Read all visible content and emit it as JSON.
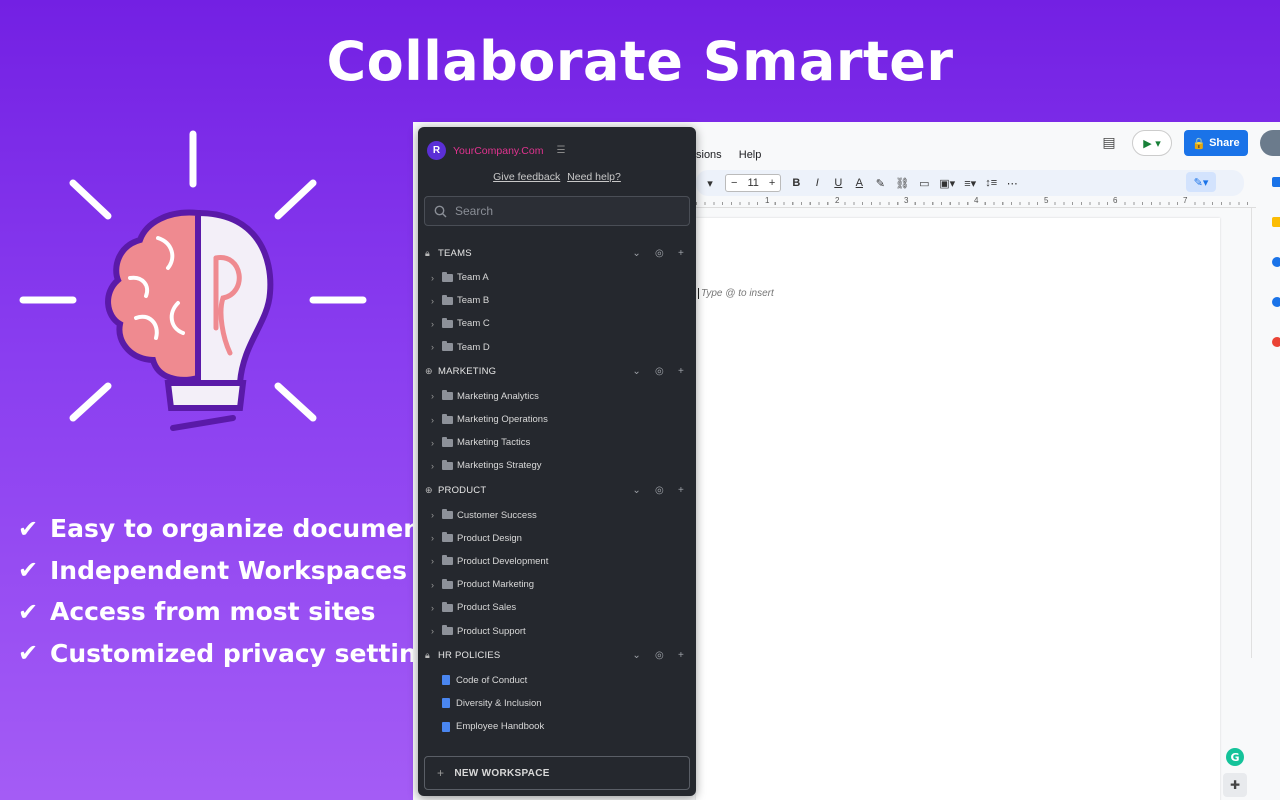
{
  "headline": "Collaborate Smarter",
  "features": [
    "Easy to organize documents",
    "Independent Workspaces",
    "Access from most sites",
    "Customized privacy settings"
  ],
  "docs": {
    "menu": [
      "sions",
      "Help"
    ],
    "share_label": "Share",
    "font_size": "11",
    "ruler_numbers": [
      "1",
      "2",
      "3",
      "4",
      "5",
      "6",
      "7"
    ],
    "placeholder": "Type @ to insert",
    "grammarly_letter": "G"
  },
  "panel": {
    "avatar_letter": "R",
    "company": "YourCompany.Com",
    "feedback_link": "Give feedback",
    "help_link": "Need help?",
    "search_placeholder": "Search",
    "sections": [
      {
        "title": "TEAMS",
        "icon": "lock-icon",
        "items": [
          "Team A",
          "Team B",
          "Team C",
          "Team D"
        ],
        "item_type": "folder"
      },
      {
        "title": "MARKETING",
        "icon": "globe-icon",
        "items": [
          "Marketing Analytics",
          "Marketing Operations",
          "Marketing Tactics",
          "Marketings Strategy"
        ],
        "item_type": "folder"
      },
      {
        "title": "PRODUCT",
        "icon": "globe-icon",
        "items": [
          "Customer Success",
          "Product Design",
          "Product Development",
          "Product Marketing",
          "Product Sales",
          "Product Support"
        ],
        "item_type": "folder"
      },
      {
        "title": "HR POLICIES",
        "icon": "lock-icon",
        "items": [
          "Code of Conduct",
          "Diversity & Inclusion",
          "Employee Handbook"
        ],
        "item_type": "doc"
      }
    ],
    "new_workspace": "NEW WORKSPACE"
  },
  "colors": {
    "background_top": "#7320e3",
    "background_bottom": "#a45cf5",
    "panel_bg": "#25282e",
    "company_text": "#e0338f",
    "share_button": "#1a73e8"
  }
}
